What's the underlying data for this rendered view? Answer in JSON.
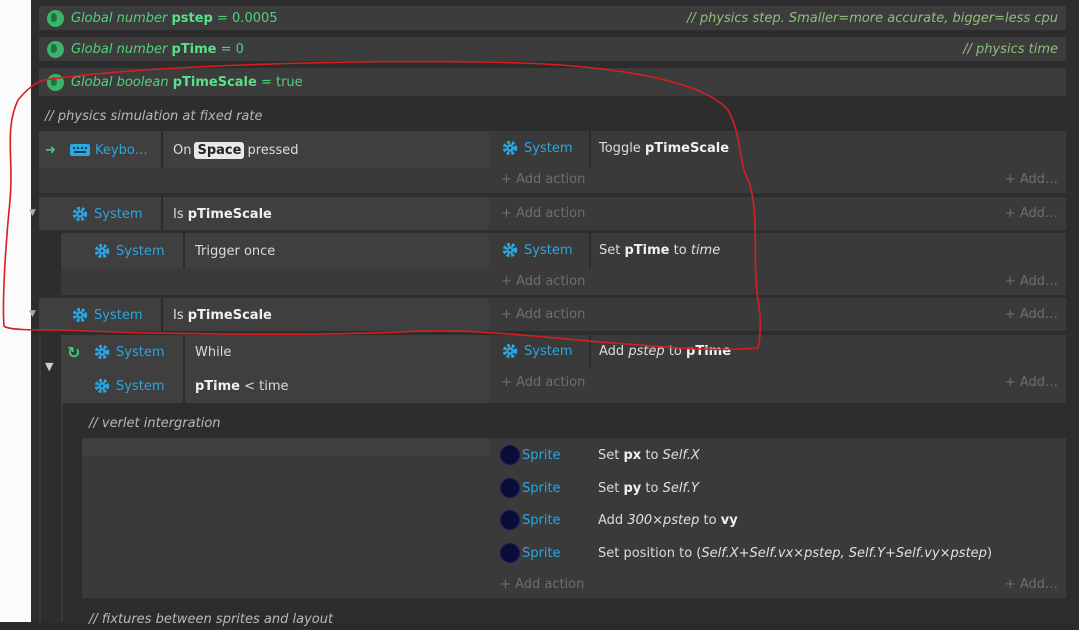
{
  "globals": [
    {
      "kind": "Global number",
      "name": "pstep",
      "assign": "= 0.0005",
      "comment": "//  physics step. Smaller=more accurate, bigger=less cpu"
    },
    {
      "kind": "Global number",
      "name": "pTime",
      "assign": "= 0",
      "comment": "//  physics time"
    },
    {
      "kind": "Global boolean",
      "name": "pTimeScale",
      "assign": "= true"
    }
  ],
  "comments": {
    "physics": "//  physics simulation at fixed rate",
    "verlet": "//  verlet intergration",
    "fixtures": "//  fixtures between sprites and layout"
  },
  "labels": {
    "system": "System",
    "sprite": "Sprite",
    "keyboard": "Keybo…",
    "add_action": "+ Add action",
    "add_more": "+ Add…"
  },
  "event1": {
    "cond_pre": "On",
    "key": "Space",
    "cond_post": "pressed",
    "act_pre": "Toggle",
    "act_var": "pTimeScale"
  },
  "event2": {
    "cond_pre": "Is",
    "cond_var": "pTimeScale"
  },
  "event3": {
    "cond": "Trigger once",
    "act_pre": "Set",
    "act_var": "pTime",
    "act_mid": "to",
    "act_val": "time"
  },
  "event4": {
    "cond_pre": "Is",
    "cond_var": "pTimeScale"
  },
  "event5": {
    "cond1": "While",
    "cond2_var": "pTime",
    "cond2_rest": "< time",
    "act_pre": "Add",
    "act_val": "pstep",
    "act_mid": "to",
    "act_var": "pTime"
  },
  "sprite_actions": [
    {
      "pre": "Set",
      "var": "px",
      "mid": "to",
      "val": "Self.X"
    },
    {
      "pre": "Set",
      "var": "py",
      "mid": "to",
      "val": "Self.Y"
    },
    {
      "pre": "Add",
      "val": "300×pstep",
      "mid": "to",
      "var": "vy"
    },
    {
      "pre": "Set position to (",
      "val": "Self.X+Self.vx×pstep, Self.Y+Self.vy×pstep",
      "post": ")"
    }
  ],
  "colors": {
    "accent": "#2aa6e0",
    "global": "#4fd37a",
    "annotation": "#d42020"
  }
}
